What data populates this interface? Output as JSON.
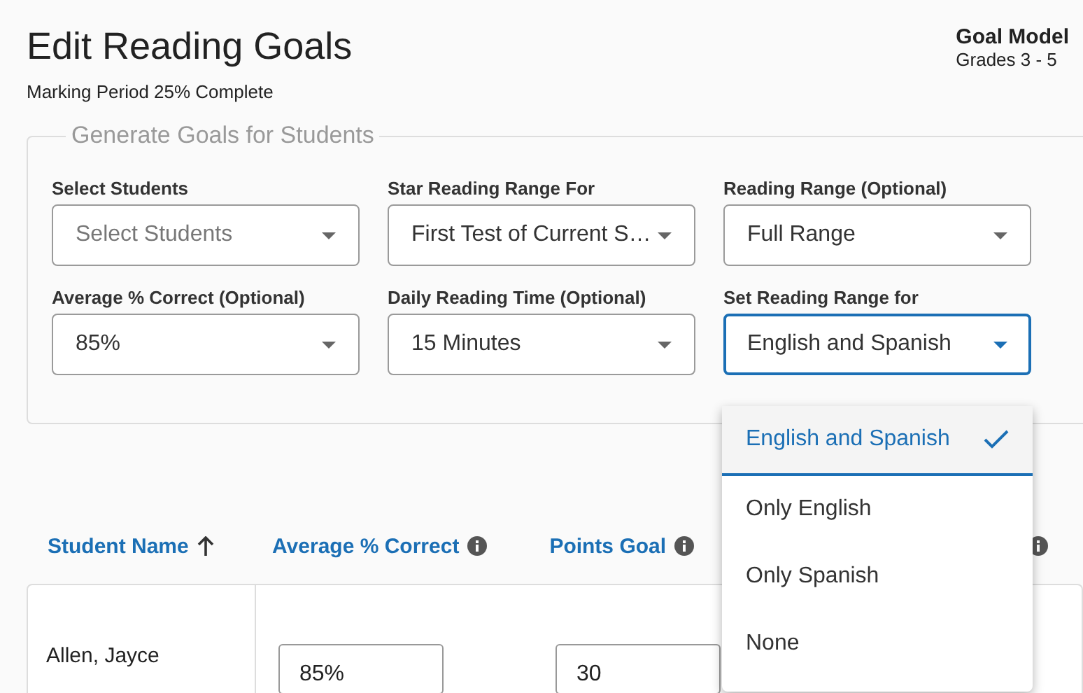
{
  "header": {
    "title": "Edit Reading Goals",
    "subtitle": "Marking Period 25% Complete",
    "model_label": "Goal Model",
    "model_value": "Grades 3 - 5"
  },
  "form": {
    "legend": "Generate Goals for Students",
    "fields": [
      {
        "label": "Select Students",
        "placeholder": "Select Students",
        "open": false
      },
      {
        "label": "Star Reading Range For",
        "value": "First Test of Current S…",
        "open": false
      },
      {
        "label": "Reading Range (Optional)",
        "value": "Full Range",
        "open": false
      },
      {
        "label": "Average % Correct (Optional)",
        "value": "85%",
        "open": false
      },
      {
        "label": "Daily Reading Time (Optional)",
        "value": "15 Minutes",
        "open": false
      },
      {
        "label": "Set Reading Range for",
        "value": "English and Spanish",
        "open": true
      }
    ]
  },
  "dropdown": {
    "options": [
      {
        "label": "English and Spanish",
        "selected": true
      },
      {
        "label": "Only English",
        "selected": false
      },
      {
        "label": "Only Spanish",
        "selected": false
      },
      {
        "label": "None",
        "selected": false
      }
    ]
  },
  "table": {
    "columns": [
      {
        "label": "Student Name",
        "sorted": true,
        "info": false
      },
      {
        "label": "Average % Correct",
        "sorted": false,
        "info": true
      },
      {
        "label": "Points Goal",
        "sorted": false,
        "info": true
      },
      {
        "sorted": false,
        "info": true
      }
    ],
    "rows": [
      {
        "name": "Allen, Jayce",
        "average": "85%",
        "points": "30"
      }
    ]
  }
}
